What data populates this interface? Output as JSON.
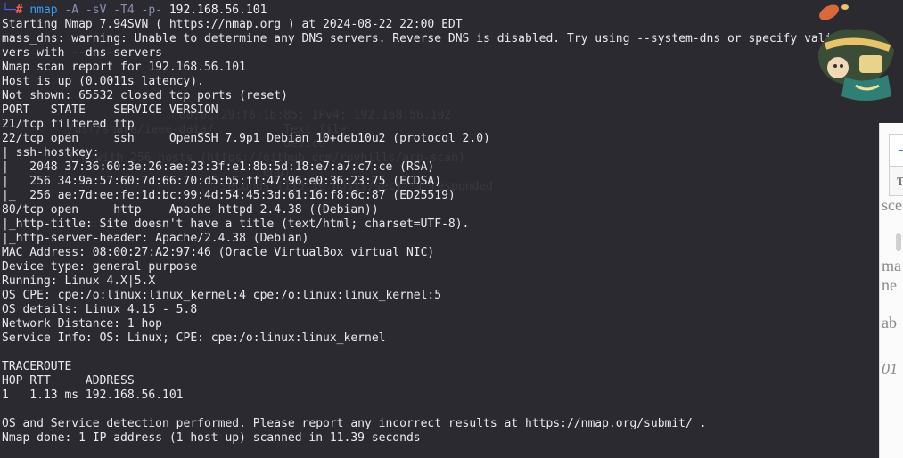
{
  "terminal": {
    "prompt": {
      "corner": "└─",
      "hash": "#",
      "command": "nmap",
      "args": "-A -sV -T4 -p-",
      "target": "192.168.56.101"
    },
    "output": [
      "Starting Nmap 7.94SVN ( https://nmap.org ) at 2024-08-22 22:00 EDT",
      "mass_dns: warning: Unable to determine any DNS servers. Reverse DNS is disabled. Try using --system-dns or specify valid ser",
      "vers with --dns-servers",
      "Nmap scan report for 192.168.56.101",
      "Host is up (0.0011s latency).",
      "Not shown: 65532 closed tcp ports (reset)",
      "PORT   STATE    SERVICE VERSION",
      "21/tcp filtered ftp",
      "22/tcp open     ssh     OpenSSH 7.9p1 Debian 10+deb10u2 (protocol 2.0)",
      "| ssh-hostkey:",
      "|   2048 37:36:60:3e:26:ae:23:3f:e1:8b:5d:18:e7:a7:c7:ce (RSA)",
      "|   256 34:9a:57:60:7d:66:70:d5:b5:ff:47:96:e0:36:23:75 (ECDSA)",
      "|_  256 ae:7d:ee:fe:1d:bc:99:4d:54:45:3d:61:16:f8:6c:87 (ED25519)",
      "80/tcp open     http    Apache httpd 2.4.38 ((Debian))",
      "|_http-title: Site doesn't have a title (text/html; charset=UTF-8).",
      "|_http-server-header: Apache/2.4.38 (Debian)",
      "MAC Address: 08:00:27:A2:97:46 (Oracle VirtualBox virtual NIC)",
      "Device type: general purpose",
      "Running: Linux 4.X|5.X",
      "OS CPE: cpe:/o:linux:linux_kernel:4 cpe:/o:linux:linux_kernel:5",
      "OS details: Linux 4.15 - 5.8",
      "Network Distance: 1 hop",
      "Service Info: OS: Linux; CPE: cpe:/o:linux:linux_kernel",
      "",
      "TRACEROUTE",
      "HOP RTT     ADDRESS",
      "1   1.13 ms 192.168.56.101",
      "",
      "OS and Service detection performed. Please report any incorrect results at https://nmap.org/submit/ .",
      "Nmap done: 1 IP address (1 host up) scanned in 11.39 seconds"
    ],
    "ghost_lines": [
      "                  08:0c:29:f6:1b:85; IPv4: 192.168.56.102",
      "  /usr/share/ieee-data/          Text file",
      "                                 device",
      "  1.0 with 256 hosts (https://github.com/royhills/arp-scan)",
      "                             (end)",
      "",
      "",
      "                        seconds (115.10 hosts/sec). 1 responded"
    ]
  },
  "side_panel": {
    "button2_label": "T",
    "fragments": [
      "sce",
      "ma",
      "ne",
      "ab",
      "01"
    ]
  }
}
